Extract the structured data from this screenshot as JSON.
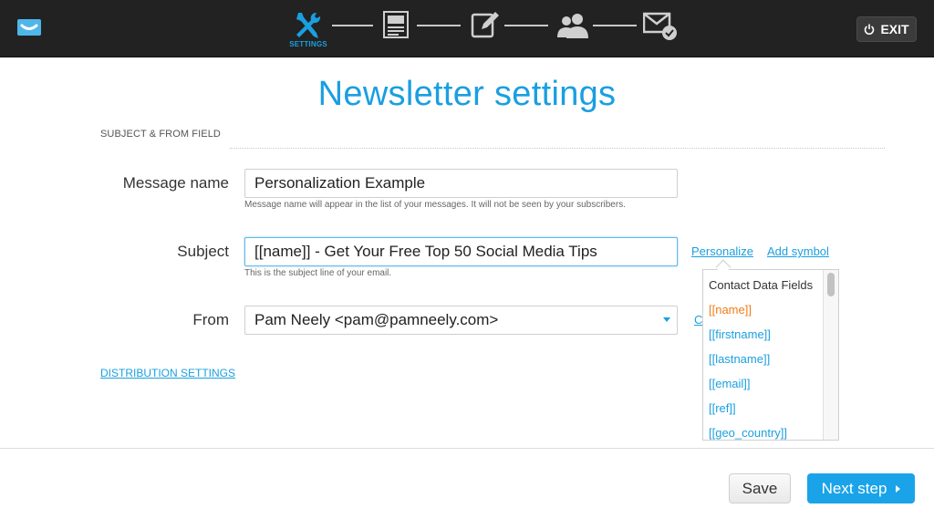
{
  "header": {
    "exit_label": "EXIT",
    "steps": [
      {
        "icon": "tools-icon",
        "label": "SETTINGS",
        "active": true
      },
      {
        "icon": "template-icon"
      },
      {
        "icon": "edit-icon"
      },
      {
        "icon": "contacts-icon"
      },
      {
        "icon": "send-icon"
      }
    ]
  },
  "colors": {
    "accent": "#1a9fe0",
    "active_item": "#f07d1a",
    "topbar": "#222222"
  },
  "page": {
    "title": "Newsletter settings",
    "section_label": "SUBJECT & FROM FIELD"
  },
  "form": {
    "message_name": {
      "label": "Message name",
      "value": "Personalization Example",
      "hint": "Message name will appear in the list of your messages. It will not be seen by your subscribers."
    },
    "subject": {
      "label": "Subject",
      "value": "[[name]] - Get Your Free Top 50 Social Media Tips",
      "hint": "This is the subject line of your email.",
      "personalize_link": "Personalize",
      "add_symbol_link": "Add symbol"
    },
    "from": {
      "label": "From",
      "value": "Pam Neely <pam@pamneely.com>",
      "side_link": "C"
    },
    "distribution_link": "DISTRIBUTION SETTINGS"
  },
  "personalize_dropdown": {
    "header": "Contact Data Fields",
    "items": [
      "[[name]]",
      "[[firstname]]",
      "[[lastname]]",
      "[[email]]",
      "[[ref]]",
      "[[geo_country]]"
    ]
  },
  "footer": {
    "save_label": "Save",
    "next_label": "Next step"
  }
}
